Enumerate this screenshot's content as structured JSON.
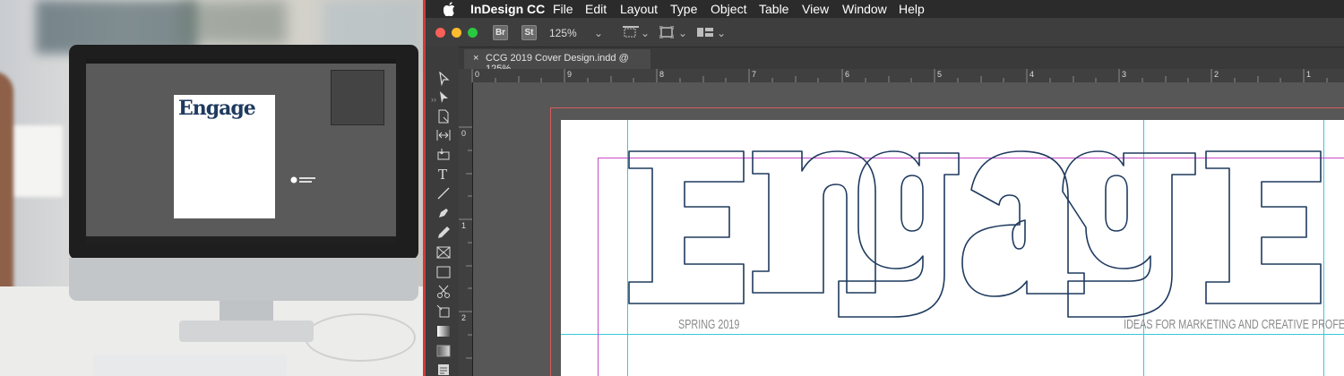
{
  "app": {
    "name": "InDesign CC",
    "menus": [
      "File",
      "Edit",
      "Layout",
      "Type",
      "Object",
      "Table",
      "View",
      "Window",
      "Help"
    ]
  },
  "controlbar": {
    "bridge_badge": "Br",
    "stock_badge": "St",
    "zoom": "125%"
  },
  "document_tab": {
    "close_glyph": "×",
    "title": "CCG 2019 Cover Design.indd @ 125%"
  },
  "ruler": {
    "horizontal": [
      "0",
      "9",
      "8",
      "7",
      "6",
      "5",
      "4",
      "3",
      "2",
      "1"
    ],
    "vertical": [
      "0",
      "1",
      "2"
    ]
  },
  "cover": {
    "masthead": "Engage",
    "season": "SPRING 2019",
    "tagline": "IDEAS FOR MARKETING AND CREATIVE PROFESSIONALS"
  },
  "mini_screen": {
    "masthead": "Engage"
  },
  "colors": {
    "masthead_outline": "#1f3a5f",
    "guide_cyan": "#39c9d6",
    "margin_magenta": "#c94bc9",
    "bleed_red": "#d85c5c"
  },
  "tools": [
    "selection-icon",
    "direct-selection-icon",
    "page-tool-icon",
    "gap-tool-icon",
    "content-collector-icon",
    "type-tool-icon",
    "line-tool-icon",
    "pen-tool-icon",
    "pencil-tool-icon",
    "rectangle-frame-icon",
    "rectangle-tool-icon",
    "scissors-icon",
    "free-transform-icon",
    "gradient-swatch-icon",
    "gradient-feather-icon",
    "note-tool-icon"
  ]
}
